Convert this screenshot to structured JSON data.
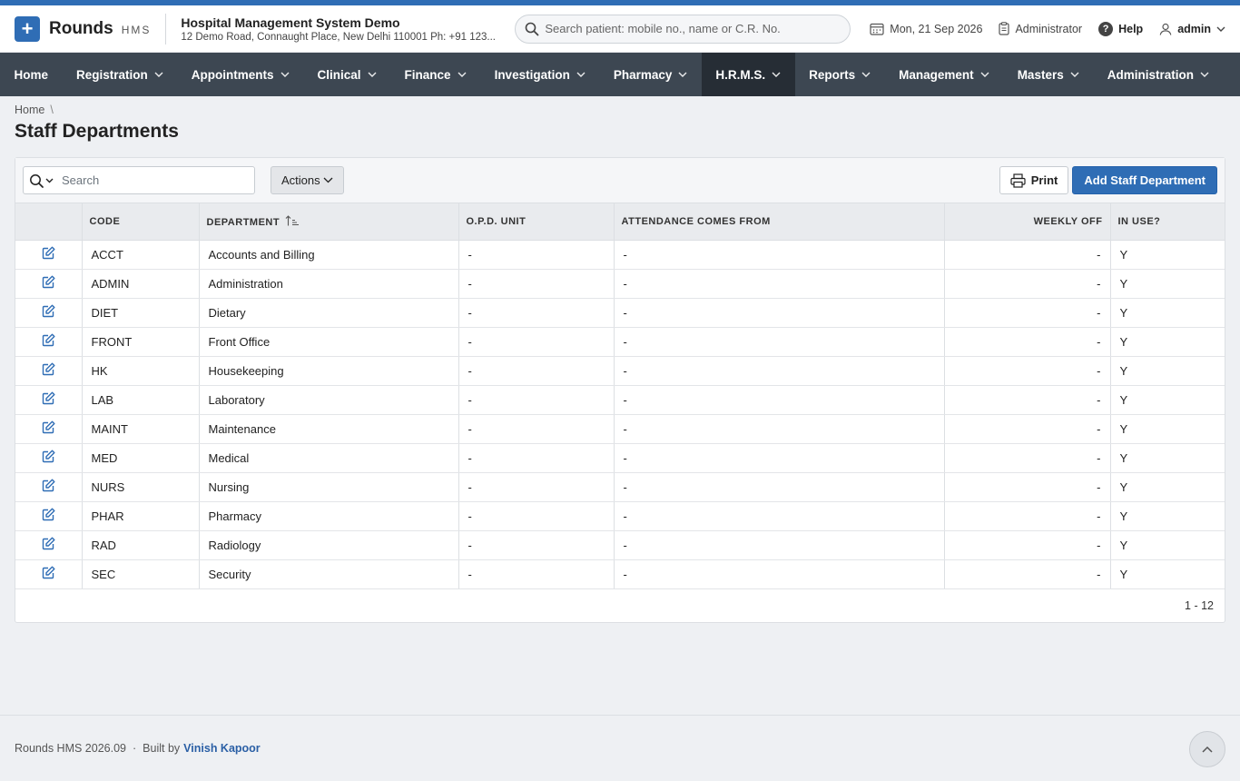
{
  "brand": {
    "name": "Rounds",
    "suffix": "HMS"
  },
  "hospital": {
    "name": "Hospital Management System Demo",
    "address": "12 Demo Road, Connaught Place, New Delhi 110001 Ph: +91 123..."
  },
  "global_search": {
    "placeholder": "Search patient: mobile no., name or C.R. No."
  },
  "header": {
    "date": "Mon, 21 Sep 2026",
    "role": "Administrator",
    "help": "Help",
    "user": "admin"
  },
  "nav": [
    {
      "label": "Home",
      "has_dropdown": false,
      "active": false
    },
    {
      "label": "Registration",
      "has_dropdown": true,
      "active": false
    },
    {
      "label": "Appointments",
      "has_dropdown": true,
      "active": false
    },
    {
      "label": "Clinical",
      "has_dropdown": true,
      "active": false
    },
    {
      "label": "Finance",
      "has_dropdown": true,
      "active": false
    },
    {
      "label": "Investigation",
      "has_dropdown": true,
      "active": false
    },
    {
      "label": "Pharmacy",
      "has_dropdown": true,
      "active": false
    },
    {
      "label": "H.R.M.S.",
      "has_dropdown": true,
      "active": true
    },
    {
      "label": "Reports",
      "has_dropdown": true,
      "active": false
    },
    {
      "label": "Management",
      "has_dropdown": true,
      "active": false
    },
    {
      "label": "Masters",
      "has_dropdown": true,
      "active": false
    },
    {
      "label": "Administration",
      "has_dropdown": true,
      "active": false
    }
  ],
  "breadcrumb": {
    "home": "Home",
    "separator": "\\"
  },
  "page": {
    "title": "Staff Departments"
  },
  "toolbar": {
    "search_placeholder": "Search",
    "actions_label": "Actions",
    "print_label": "Print",
    "add_label": "Add Staff Department"
  },
  "table": {
    "columns": {
      "code": "CODE",
      "department": "DEPARTMENT",
      "opd_unit": "O.P.D. UNIT",
      "attendance": "ATTENDANCE COMES FROM",
      "weekly_off": "WEEKLY OFF",
      "in_use": "IN USE?"
    },
    "rows": [
      {
        "code": "ACCT",
        "department": "Accounts and Billing",
        "opd_unit": "-",
        "attendance": "-",
        "weekly_off": "-",
        "in_use": "Y"
      },
      {
        "code": "ADMIN",
        "department": "Administration",
        "opd_unit": "-",
        "attendance": "-",
        "weekly_off": "-",
        "in_use": "Y"
      },
      {
        "code": "DIET",
        "department": "Dietary",
        "opd_unit": "-",
        "attendance": "-",
        "weekly_off": "-",
        "in_use": "Y"
      },
      {
        "code": "FRONT",
        "department": "Front Office",
        "opd_unit": "-",
        "attendance": "-",
        "weekly_off": "-",
        "in_use": "Y"
      },
      {
        "code": "HK",
        "department": "Housekeeping",
        "opd_unit": "-",
        "attendance": "-",
        "weekly_off": "-",
        "in_use": "Y"
      },
      {
        "code": "LAB",
        "department": "Laboratory",
        "opd_unit": "-",
        "attendance": "-",
        "weekly_off": "-",
        "in_use": "Y"
      },
      {
        "code": "MAINT",
        "department": "Maintenance",
        "opd_unit": "-",
        "attendance": "-",
        "weekly_off": "-",
        "in_use": "Y"
      },
      {
        "code": "MED",
        "department": "Medical",
        "opd_unit": "-",
        "attendance": "-",
        "weekly_off": "-",
        "in_use": "Y"
      },
      {
        "code": "NURS",
        "department": "Nursing",
        "opd_unit": "-",
        "attendance": "-",
        "weekly_off": "-",
        "in_use": "Y"
      },
      {
        "code": "PHAR",
        "department": "Pharmacy",
        "opd_unit": "-",
        "attendance": "-",
        "weekly_off": "-",
        "in_use": "Y"
      },
      {
        "code": "RAD",
        "department": "Radiology",
        "opd_unit": "-",
        "attendance": "-",
        "weekly_off": "-",
        "in_use": "Y"
      },
      {
        "code": "SEC",
        "department": "Security",
        "opd_unit": "-",
        "attendance": "-",
        "weekly_off": "-",
        "in_use": "Y"
      }
    ],
    "pagination": "1 - 12"
  },
  "footer": {
    "version": "Rounds HMS 2026.09",
    "separator": "·",
    "built_by": "Built by",
    "author": "Vinish Kapoor"
  },
  "colors": {
    "accent": "#2f6db5",
    "nav_bg": "#3d4752",
    "nav_active": "#262d35"
  },
  "icons": {
    "logo": "plus-icon",
    "search": "search-icon",
    "date": "calendar-icon",
    "role": "clipboard-icon",
    "help": "question-circle-icon",
    "user": "user-icon",
    "edit": "edit-icon",
    "print": "printer-icon",
    "sort": "sort-ascending-icon",
    "scroll_top": "chevron-up-icon"
  }
}
